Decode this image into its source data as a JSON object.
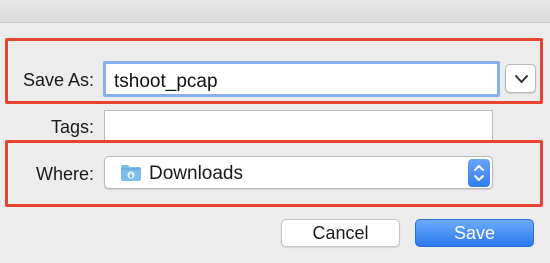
{
  "dialog": {
    "save_as_label": "Save As:",
    "save_as_value": "tshoot_pcap",
    "tags_label": "Tags:",
    "tags_value": "",
    "where_label": "Where:",
    "where_value": "Downloads",
    "where_icon": "downloads-folder-icon",
    "expand_icon": "chevron-down-icon",
    "cancel_label": "Cancel",
    "save_label": "Save"
  },
  "colors": {
    "highlight": "#e8432e",
    "accent": "#2f7df2",
    "focus_ring": "#86b0ea",
    "background": "#ececec"
  }
}
